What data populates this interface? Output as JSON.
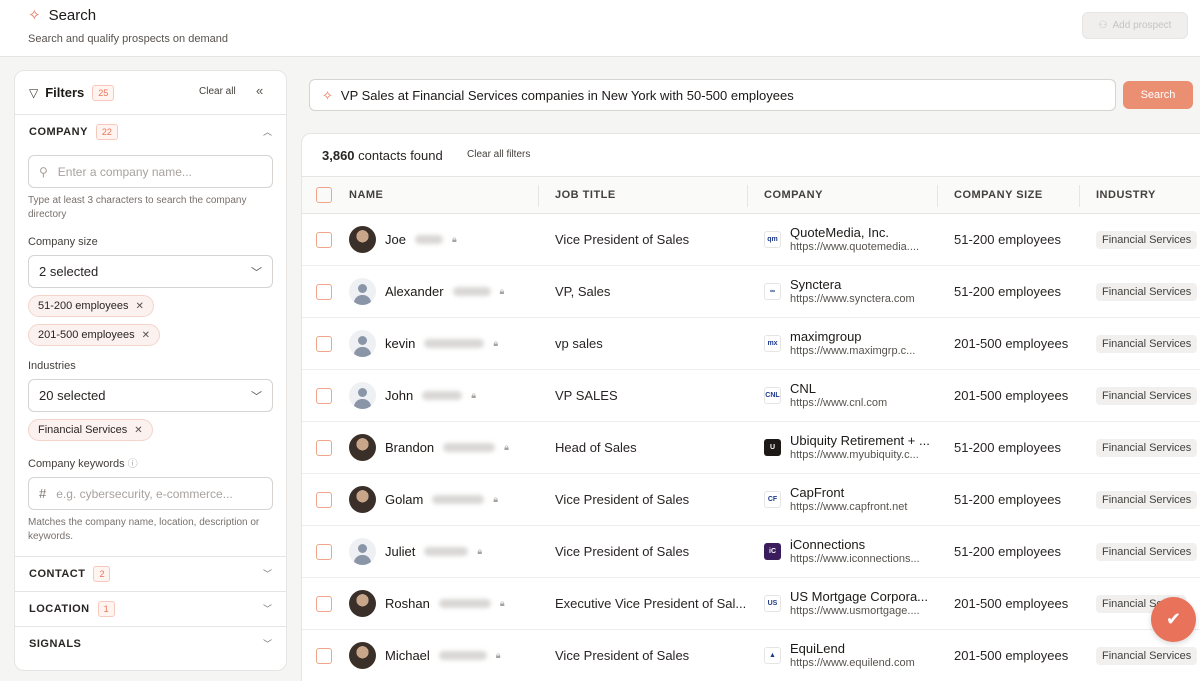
{
  "header": {
    "title": "Search",
    "subtitle": "Search and qualify prospects on demand",
    "add_prospect": "Add prospect",
    "accent": "#e8735a"
  },
  "filters": {
    "title": "Filters",
    "count": "25",
    "clear_all": "Clear all",
    "company": {
      "label": "COMPANY",
      "count": "22",
      "search_placeholder": "Enter a company name...",
      "search_helper": "Type at least 3 characters to search the company directory",
      "size_label": "Company size",
      "size_value": "2 selected",
      "size_chips": [
        "51-200 employees",
        "201-500 employees"
      ],
      "industries_label": "Industries",
      "industries_value": "20 selected",
      "industry_chips": [
        "Financial Services"
      ],
      "keywords_label": "Company keywords",
      "keywords_placeholder": "e.g. cybersecurity, e-commerce...",
      "keywords_helper": "Matches the company name, location, description or keywords."
    },
    "contact": {
      "label": "CONTACT",
      "count": "2"
    },
    "location": {
      "label": "LOCATION",
      "count": "1"
    },
    "signals": {
      "label": "SIGNALS"
    }
  },
  "search": {
    "query": "VP Sales at Financial Services companies in New York with 50-500 employees",
    "button": "Search"
  },
  "results": {
    "count": "3,860",
    "count_suffix": "contacts found",
    "clear_filters": "Clear all filters",
    "columns": [
      "NAME",
      "JOB TITLE",
      "COMPANY",
      "COMPANY SIZE",
      "INDUSTRY"
    ],
    "rows": [
      {
        "name": "Joe",
        "title": "Vice President of Sales",
        "company": "QuoteMedia, Inc.",
        "url": "https://www.quotemedia....",
        "size": "51-200 employees",
        "industry": "Financial Services",
        "avatar": "photo",
        "logo_color": "#ffffff",
        "logo_text": "qm"
      },
      {
        "name": "Alexander",
        "title": "VP, Sales",
        "company": "Synctera",
        "url": "https://www.synctera.com",
        "size": "51-200 employees",
        "industry": "Financial Services",
        "avatar": "placeholder",
        "logo_color": "#ffffff",
        "logo_text": "∞"
      },
      {
        "name": "kevin",
        "title": "vp sales",
        "company": "maximgroup",
        "url": "https://www.maximgrp.c...",
        "size": "201-500 employees",
        "industry": "Financial Services",
        "avatar": "placeholder",
        "logo_color": "#ffffff",
        "logo_text": "mx"
      },
      {
        "name": "John",
        "title": "VP SALES",
        "company": "CNL",
        "url": "https://www.cnl.com",
        "size": "201-500 employees",
        "industry": "Financial Services",
        "avatar": "placeholder",
        "logo_color": "#ffffff",
        "logo_text": "CNL"
      },
      {
        "name": "Brandon",
        "title": "Head of Sales",
        "company": "Ubiquity Retirement + ...",
        "url": "https://www.myubiquity.c...",
        "size": "51-200 employees",
        "industry": "Financial Services",
        "avatar": "photo",
        "logo_color": "#1c1917",
        "logo_text": "U"
      },
      {
        "name": "Golam",
        "title": "Vice President of Sales",
        "company": "CapFront",
        "url": "https://www.capfront.net",
        "size": "51-200 employees",
        "industry": "Financial Services",
        "avatar": "photo",
        "logo_color": "#ffffff",
        "logo_text": "CF"
      },
      {
        "name": "Juliet",
        "title": "Vice President of Sales",
        "company": "iConnections",
        "url": "https://www.iconnections...",
        "size": "51-200 employees",
        "industry": "Financial Services",
        "avatar": "placeholder",
        "logo_color": "#3b1d5e",
        "logo_text": "iC"
      },
      {
        "name": "Roshan",
        "title": "Executive Vice President of Sal...",
        "company": "US Mortgage Corpora...",
        "url": "https://www.usmortgage....",
        "size": "201-500 employees",
        "industry": "Financial Servic",
        "avatar": "photo",
        "logo_color": "#ffffff",
        "logo_text": "US"
      },
      {
        "name": "Michael",
        "title": "Vice President of Sales",
        "company": "EquiLend",
        "url": "https://www.equilend.com",
        "size": "201-500 employees",
        "industry": "Financial Services",
        "avatar": "photo",
        "logo_color": "#ffffff",
        "logo_text": "▲"
      }
    ]
  }
}
